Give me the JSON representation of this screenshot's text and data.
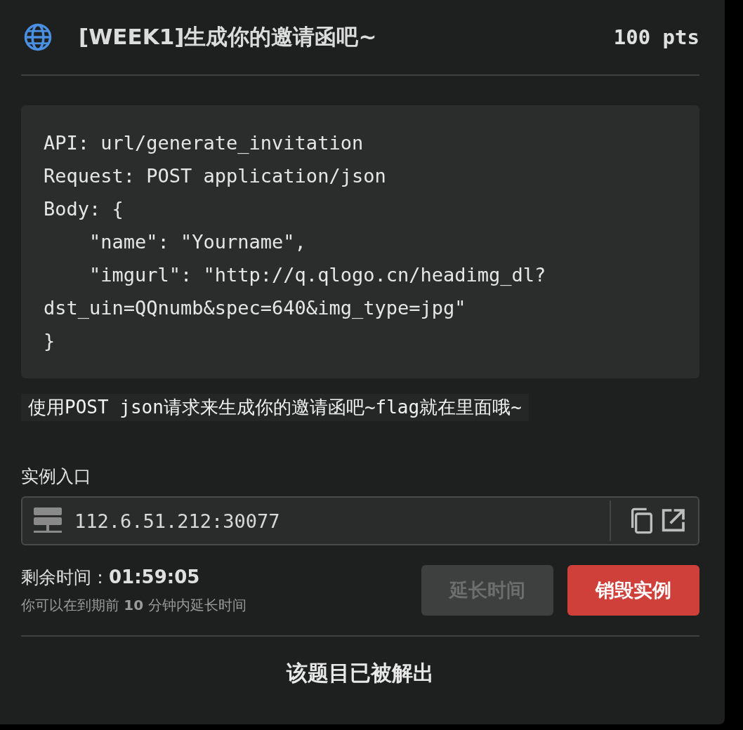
{
  "header": {
    "title": "[WEEK1]生成你的邀请函吧~",
    "points": "100 pts"
  },
  "code_lines": [
    "API: url/generate_invitation",
    "Request: POST application/json",
    "Body: {",
    "    \"name\": \"Yourname\",",
    "    \"imgurl\": \"http://q.qlogo.cn/headimg_dl?",
    "dst_uin=QQnumb&spec=640&img_type=jpg\"",
    "}"
  ],
  "description": "使用POST json请求来生成你的邀请函吧~flag就在里面哦~",
  "instance": {
    "label": "实例入口",
    "address": "112.6.51.212:30077"
  },
  "timer": {
    "label": "剩余时间：",
    "value": "01:59:05",
    "hint": "你可以在到期前 **10** 分钟内延长时间"
  },
  "buttons": [
    {
      "label": "延长时间",
      "kind": "extend",
      "disabled": true
    },
    {
      "label": "销毁实例",
      "kind": "destroy",
      "disabled": false
    }
  ],
  "status": "该题目已被解出"
}
